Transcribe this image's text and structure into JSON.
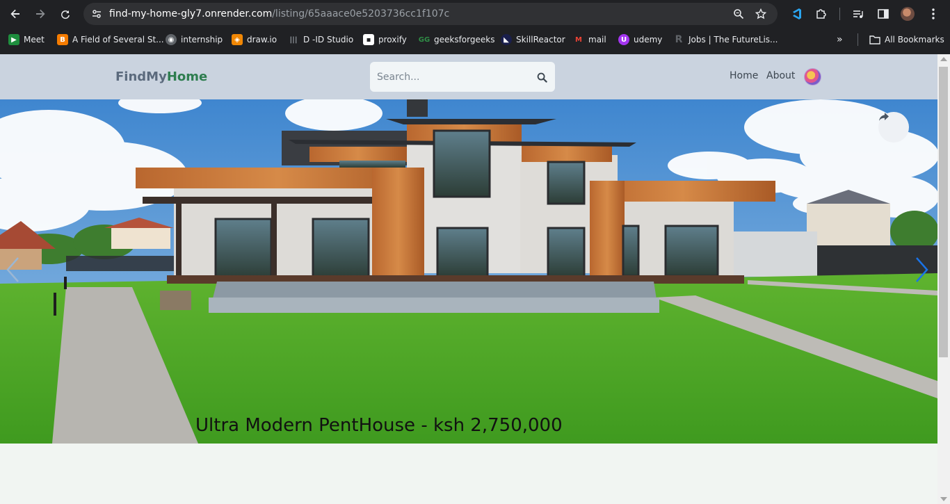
{
  "browser": {
    "url_host": "find-my-home-gly7.onrender.com",
    "url_path": "/listing/65aaace0e5203736cc1f107c",
    "bookmarks": [
      {
        "label": "Meet",
        "color": "#1e8e3e",
        "glyph": "M"
      },
      {
        "label": "A Field of Several St...",
        "color": "#f57c00",
        "glyph": "B"
      },
      {
        "label": "internship",
        "color": "#5f6368",
        "glyph": "◉"
      },
      {
        "label": "draw.io",
        "color": "#f08705",
        "glyph": "◈"
      },
      {
        "label": "D -ID Studio",
        "color": "#3c4043",
        "glyph": "|||"
      },
      {
        "label": "proxify",
        "color": "#ffffff",
        "glyph": "▪"
      },
      {
        "label": "geeksforgeeks",
        "color": "#2f8d46",
        "glyph": "GG"
      },
      {
        "label": "SkillReactor",
        "color": "#1a1f4c",
        "glyph": "◣"
      },
      {
        "label": "mail",
        "color": "#ea4335",
        "glyph": "M"
      },
      {
        "label": "udemy",
        "color": "#a435f0",
        "glyph": "U"
      },
      {
        "label": "Jobs | The FutureLis...",
        "color": "#3c4043",
        "glyph": "R"
      }
    ],
    "all_bookmarks_label": "All Bookmarks"
  },
  "navbar": {
    "brand_part1": "FindMy",
    "brand_part2": "Home",
    "search_placeholder": "Search...",
    "links": [
      "Home",
      "About"
    ]
  },
  "listing": {
    "title": "Ultra Modern PentHouse - ksh 2,750,000"
  },
  "colors": {
    "navbar_bg": "#cad3df",
    "brand_green": "#2e7d4f",
    "brand_gray": "#5b6a7d",
    "page_bg": "#f1f5f2"
  }
}
